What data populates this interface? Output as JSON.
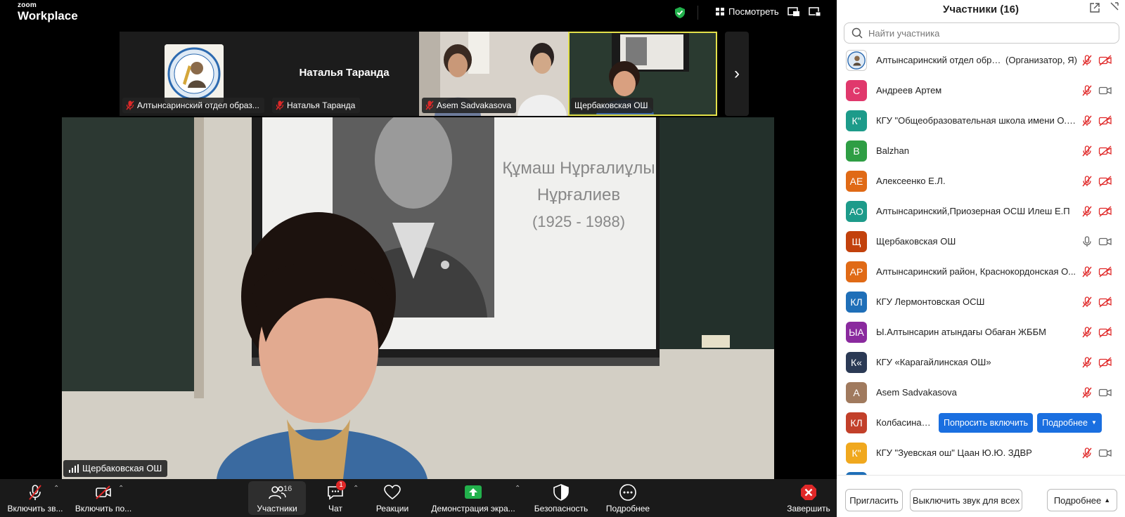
{
  "app": {
    "logo_line1": "zoom",
    "logo_line2": "Workplace"
  },
  "topbar": {
    "view_label": "Посмотреть"
  },
  "thumbnails": [
    {
      "name": "Алтынсаринский отдел образ...",
      "muted": true
    },
    {
      "name": "Наталья Таранда",
      "display_name": "Наталья Таранда",
      "muted": true
    },
    {
      "name": "Asem Sadvakasova",
      "muted": true
    },
    {
      "name": "Щербаковская ОШ",
      "muted": false,
      "active_speaker": true
    }
  ],
  "main_video": {
    "name": "Щербаковская ОШ",
    "slide_title_line1": "Құмаш Нұрғалиұлы",
    "slide_title_line2": "Нұрғалиев",
    "slide_years": "(1925 - 1988)"
  },
  "toolbar": {
    "audio_label": "Включить зв...",
    "video_label": "Включить по...",
    "participants_label": "Участники",
    "participants_count": "16",
    "chat_label": "Чат",
    "chat_badge": "1",
    "reactions_label": "Реакции",
    "share_label": "Демонстрация экра...",
    "security_label": "Безопасность",
    "more_label": "Подробнее",
    "end_label": "Завершить"
  },
  "panel": {
    "title": "Участники (16)",
    "search_placeholder": "Найти участника",
    "participants": [
      {
        "initials": "",
        "name": "Алтынсаринский отдел образ...",
        "role": "(Организатор, Я)",
        "color": "#ffffff",
        "mic": "off",
        "cam": "off",
        "logo": true
      },
      {
        "initials": "С",
        "name": "Андреев Артем",
        "color": "#e0386c",
        "mic": "off",
        "cam": "on"
      },
      {
        "initials": "К\"",
        "name": "КГУ \"Общеобразовательная школа имени О.Ш...",
        "color": "#1d9b8a",
        "mic": "off",
        "cam": "off"
      },
      {
        "initials": "B",
        "name": "Balzhan",
        "color": "#2e9e44",
        "mic": "off",
        "cam": "off"
      },
      {
        "initials": "АЕ",
        "name": "Алексеенко Е.Л.",
        "color": "#e06a16",
        "mic": "off",
        "cam": "off"
      },
      {
        "initials": "АО",
        "name": "Алтынсаринский,Приозерная ОСШ Илеш Е.П",
        "color": "#1d9b8a",
        "mic": "off",
        "cam": "off"
      },
      {
        "initials": "Щ",
        "name": "Щербаковская ОШ",
        "color": "#c2410c",
        "mic": "on",
        "cam": "on"
      },
      {
        "initials": "АР",
        "name": "Алтынсаринский район, Краснокордонская О...",
        "color": "#e06a16",
        "mic": "off",
        "cam": "off"
      },
      {
        "initials": "КЛ",
        "name": "КГУ Лермонтовская ОСШ",
        "color": "#1f6fb8",
        "mic": "off",
        "cam": "off"
      },
      {
        "initials": "ЫА",
        "name": "Ы.Алтынсарин атындағы Обаған ЖББМ",
        "color": "#8a2a9e",
        "mic": "off",
        "cam": "off"
      },
      {
        "initials": "К«",
        "name": "КГУ «Карагайлинская ОШ»",
        "color": "#2b3a55",
        "mic": "off",
        "cam": "off"
      },
      {
        "initials": "A",
        "name": "Asem Sadvakasova",
        "color": "#a07a5e",
        "mic": "off",
        "cam": "on"
      },
      {
        "initials": "КЛ",
        "name": "Колбасина Л...",
        "color": "#c2402a",
        "hover": true
      },
      {
        "initials": "К\"",
        "name": "КГУ \"Зуевская ош\" Цаан Ю.Ю. ЗДВР",
        "color": "#f0a81e",
        "mic": "off",
        "cam": "on"
      }
    ],
    "ask_unmute_label": "Попросить включить",
    "row_more_label": "Подробнее",
    "invite_label": "Пригласить",
    "mute_all_label": "Выключить звук для всех",
    "more_label": "Подробнее"
  },
  "colors": {
    "accent": "#1a6fe0",
    "mute_red": "#e02828",
    "share_green": "#22b14c",
    "speaker_border": "#e3e04a"
  }
}
